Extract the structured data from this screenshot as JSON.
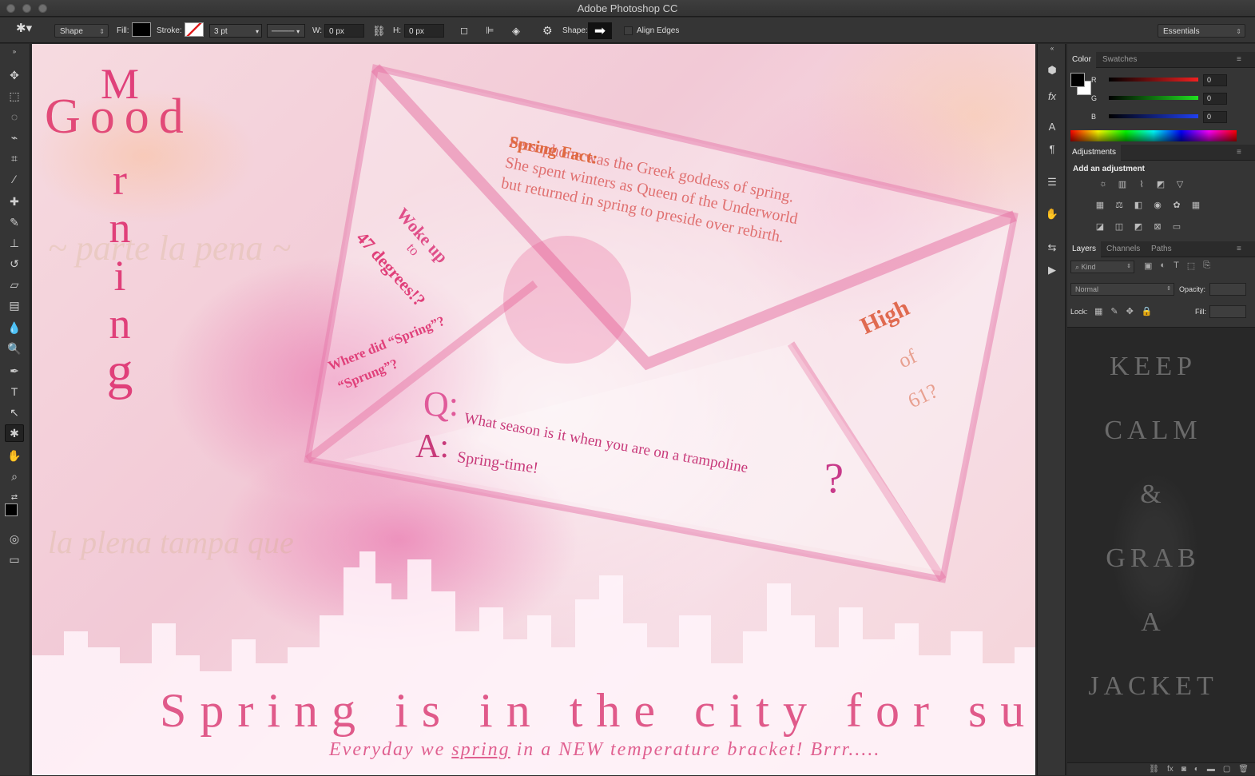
{
  "window": {
    "title": "Adobe Photoshop CC"
  },
  "options_bar": {
    "tool_mode": "Shape",
    "fill_label": "Fill:",
    "stroke_label": "Stroke:",
    "stroke_width": "3 pt",
    "width_label": "W:",
    "width_value": "0 px",
    "height_label": "H:",
    "height_value": "0 px",
    "shape_label": "Shape:",
    "align_edges_label": "Align Edges",
    "workspace": "Essentials"
  },
  "toolbar": {
    "tools": [
      "move-icon",
      "marquee-icon",
      "lasso-icon",
      "quick-select-icon",
      "crop-icon",
      "eyedropper-icon",
      "healing-icon",
      "brush-icon",
      "stamp-icon",
      "history-brush-icon",
      "eraser-icon",
      "gradient-icon",
      "blur-icon",
      "dodge-icon",
      "pen-icon",
      "type-icon",
      "path-select-icon",
      "custom-shape-icon",
      "hand-icon",
      "zoom-icon"
    ],
    "active_tool": "custom-shape-icon"
  },
  "poster": {
    "good": "Good",
    "morning_letters": [
      "M",
      "o",
      "r",
      "n",
      "i",
      "n",
      "g"
    ],
    "spring_fact_title": "Spring Fact:",
    "spring_fact_lines": [
      "Persephone was the Greek goddess of spring.",
      "She spent winters as Queen of the Underworld",
      "but returned in spring to preside over rebirth."
    ],
    "woke_up": "Woke up",
    "to": "to",
    "degrees": "47 degrees!?",
    "where_line1": "Where did “Spring”?",
    "where_line2": "“Sprung”?",
    "high": "High",
    "of": "of",
    "sixty_one": "61?",
    "q_letter": "Q:",
    "question": "What season is it when you are on a trampoline",
    "question_mark": "?",
    "a_letter": "A:",
    "answer": "Spring-time!",
    "headline": "Spring is in the city for sure!",
    "sub_before": "Everyday we ",
    "sub_underlined": "spring",
    "sub_after": " in a NEW temperature bracket! Brrr....."
  },
  "color_panel": {
    "tabs": [
      "Color",
      "Swatches"
    ],
    "active_tab": "Color",
    "channels": [
      {
        "label": "R",
        "value": "0",
        "color": "#e03030"
      },
      {
        "label": "G",
        "value": "0",
        "color": "#30c030"
      },
      {
        "label": "B",
        "value": "0",
        "color": "#3050e0"
      }
    ]
  },
  "adjustments_panel": {
    "tab": "Adjustments",
    "heading": "Add an adjustment",
    "rows": [
      [
        "brightness-icon",
        "levels-icon",
        "curves-icon",
        "exposure-icon",
        "vibrance-icon"
      ],
      [
        "hue-sat-icon",
        "color-balance-icon",
        "bw-icon",
        "photo-filter-icon",
        "channel-mixer-icon",
        "color-lookup-icon"
      ],
      [
        "invert-icon",
        "posterize-icon",
        "threshold-icon",
        "selective-color-icon",
        "gradient-map-icon"
      ]
    ]
  },
  "layers_panel": {
    "tabs": [
      "Layers",
      "Channels",
      "Paths"
    ],
    "active_tab": "Layers",
    "filter_kind": "Kind",
    "blend_mode": "Normal",
    "opacity_label": "Opacity:",
    "lock_label": "Lock:",
    "fill_label": "Fill:",
    "preview_text": [
      "KEEP",
      "CALM",
      "&",
      "GRAB",
      "A",
      "JACKET"
    ]
  },
  "colors": {
    "accent_pink": "#e0408a",
    "text_orange": "#e06040",
    "headline_pink": "#e05a8a"
  }
}
